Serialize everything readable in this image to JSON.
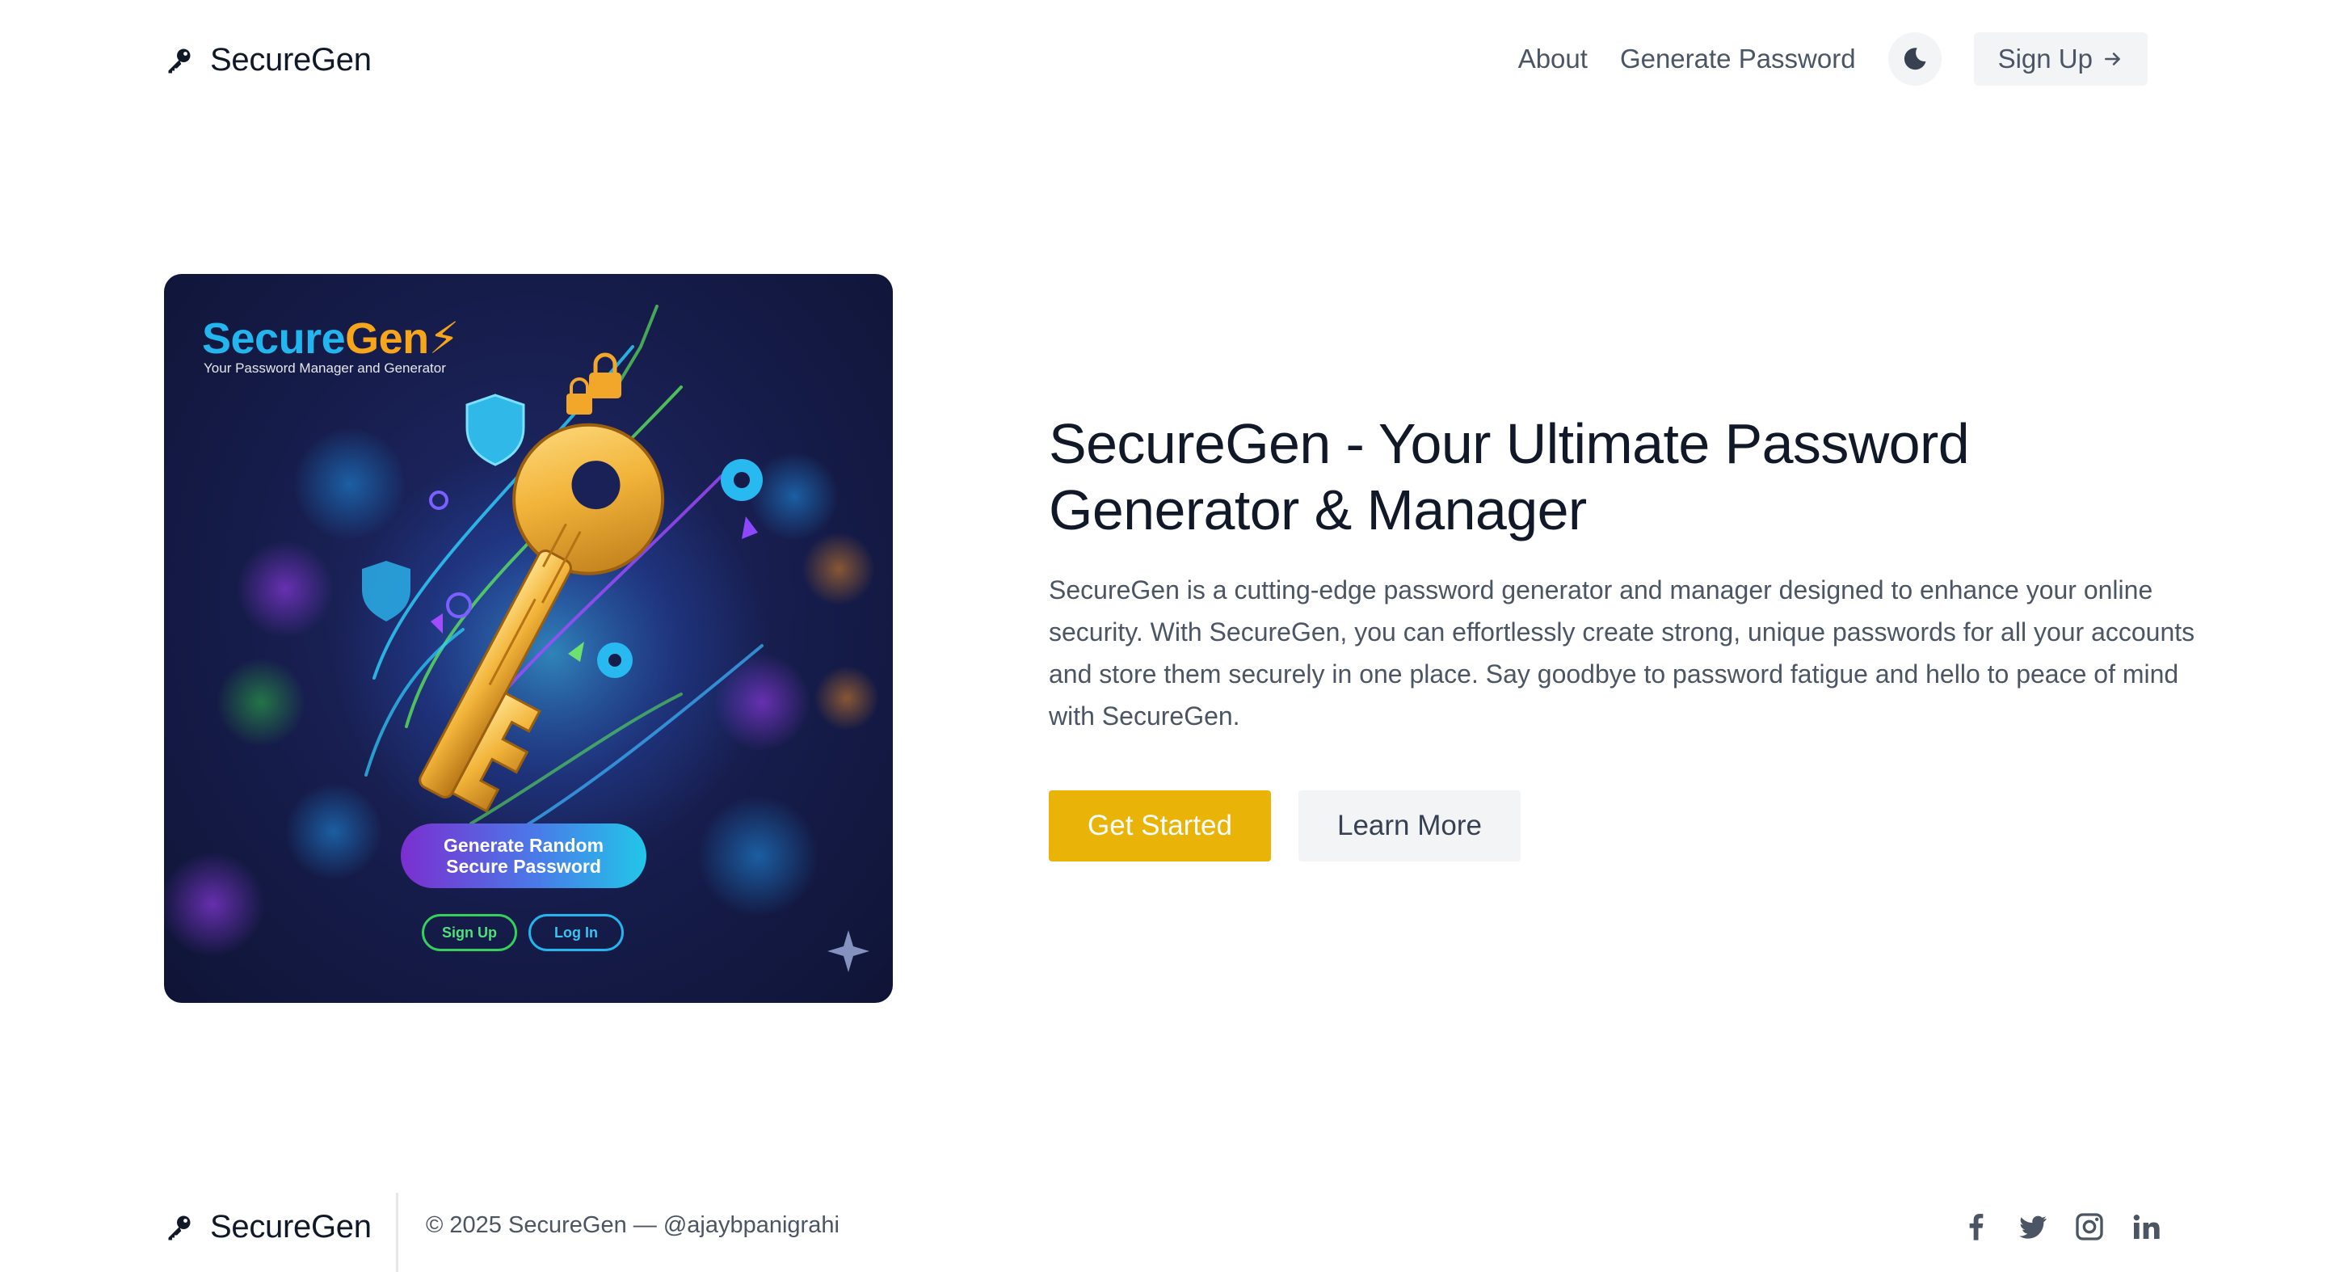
{
  "brand": {
    "name": "SecureGen",
    "icon": "key-icon"
  },
  "nav": {
    "links": [
      "About",
      "Generate Password"
    ],
    "theme_toggle_icon": "moon-icon",
    "signup_label": "Sign Up",
    "signup_icon": "arrow-right-icon"
  },
  "hero": {
    "image": {
      "title_part1": "Secure",
      "title_part2": "Gen",
      "subtitle": "Your Password Manager and Generator",
      "cta": "Generate Random\nSecure Password",
      "signup": "Sign Up",
      "login": "Log In"
    },
    "title": "SecureGen - Your Ultimate Password Generator & Manager",
    "description": "SecureGen is a cutting-edge password generator and manager designed to enhance your online security. With SecureGen, you can effortlessly create strong, unique passwords for all your accounts and store them securely in one place. Say goodbye to password fatigue and hello to peace of mind with SecureGen.",
    "primary_button": "Get Started",
    "secondary_button": "Learn More"
  },
  "footer": {
    "brand": "SecureGen",
    "copyright": "© 2025 SecureGen — ",
    "handle": "@ajaybpanigrahi",
    "social_icons": [
      "facebook-icon",
      "twitter-icon",
      "instagram-icon",
      "linkedin-icon"
    ]
  },
  "colors": {
    "accent": "#eab308",
    "text_primary": "#111827",
    "text_secondary": "#4b5563",
    "button_gray": "#f3f4f6"
  }
}
